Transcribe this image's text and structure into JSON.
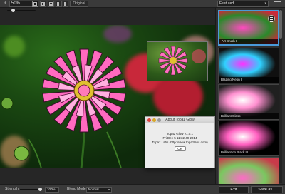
{
  "toolbar": {
    "zoom_value": "50%",
    "view_buttons": [
      "single-view",
      "split-vertical",
      "split-horizontal",
      "side-by-side",
      "dual-view"
    ],
    "original_label": "Original"
  },
  "presets": {
    "category": "Featured",
    "items": [
      {
        "label": "Art Brush I",
        "selected": true
      },
      {
        "label": "Blazing Neon I",
        "selected": false
      },
      {
        "label": "Brilliant Glass I",
        "selected": false
      },
      {
        "label": "Brilliant on Black III",
        "selected": false
      },
      {
        "label": "",
        "selected": false
      }
    ]
  },
  "dialog": {
    "title": "About Topaz Glow",
    "line1": "Topaz Glow v1.0.1",
    "line2": "Fri Dec  5 11:32:49 2014",
    "line3": "Topaz Labs (http://www.topazlabs.com)",
    "ok_label": "OK"
  },
  "bottom": {
    "strength_label": "Strength",
    "strength_value": "100%",
    "strength_fraction": 0.9,
    "blend_label": "Blend Mode",
    "blend_value": "Normal",
    "exit_label": "Exit",
    "saveas_label": "Save as..."
  },
  "colors": {
    "accent": "#4a9ad8",
    "flower_pink": "#ff5ab4",
    "background": "#262626"
  }
}
